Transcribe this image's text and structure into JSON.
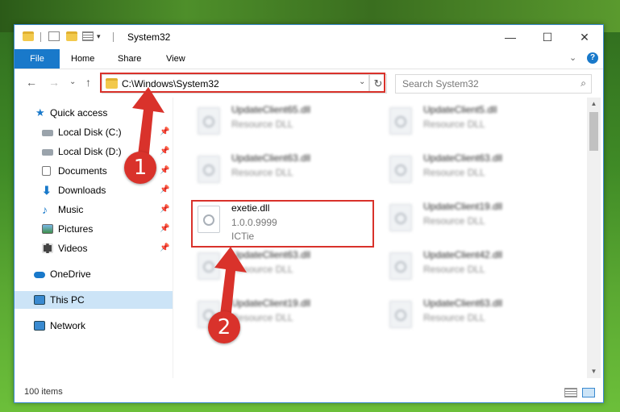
{
  "window": {
    "title": "System32",
    "controls": {
      "minimize": "—",
      "maximize": "☐",
      "close": "✕"
    }
  },
  "ribbon": {
    "file": "File",
    "home": "Home",
    "share": "Share",
    "view": "View",
    "collapse": "⌄",
    "help": "?"
  },
  "address": {
    "path": "C:\\Windows\\System32",
    "dropdown": "⌄",
    "refresh": "↻"
  },
  "search": {
    "placeholder": "Search System32",
    "icon": "⌕"
  },
  "nav": {
    "back": "←",
    "forward": "→",
    "recent": "⌄",
    "up": "↑"
  },
  "sidebar": {
    "items": [
      {
        "label": "Quick access",
        "icon": "star-icon"
      },
      {
        "label": "Local Disk (C:)",
        "icon": "drive-icon",
        "pinned": true
      },
      {
        "label": "Local Disk (D:)",
        "icon": "drive-icon",
        "pinned": true
      },
      {
        "label": "Documents",
        "icon": "documents-icon",
        "pinned": true
      },
      {
        "label": "Downloads",
        "icon": "downloads-icon",
        "pinned": true
      },
      {
        "label": "Music",
        "icon": "music-icon",
        "pinned": true
      },
      {
        "label": "Pictures",
        "icon": "pictures-icon",
        "pinned": true
      },
      {
        "label": "Videos",
        "icon": "videos-icon",
        "pinned": true
      },
      {
        "label": "OneDrive",
        "icon": "onedrive-icon"
      },
      {
        "label": "This PC",
        "icon": "pc-icon",
        "selected": true
      },
      {
        "label": "Network",
        "icon": "network-icon"
      }
    ],
    "pin_glyph": "📌"
  },
  "files": [
    {
      "name": "UpdateClient65.dll",
      "type": "Resource DLL"
    },
    {
      "name": "UpdateClient5.dll",
      "type": "Resource DLL"
    },
    {
      "name": "UpdateClient63.dll",
      "type": "Resource DLL"
    },
    {
      "name": "UpdateClient63.dll",
      "type": "Resource DLL"
    },
    {
      "name": "exetie.dll",
      "version": "1.0.0.9999",
      "company": "ICTie",
      "highlighted": true
    },
    {
      "name": "UpdateClient19.dll",
      "type": "Resource DLL"
    },
    {
      "name": "UpdateClient63.dll",
      "type": "Resource DLL"
    },
    {
      "name": "UpdateClient42.dll",
      "type": "Resource DLL"
    },
    {
      "name": "UpdateClient19.dll",
      "type": "Resource DLL"
    },
    {
      "name": "UpdateClient63.dll",
      "type": "Resource DLL"
    }
  ],
  "status": {
    "count": "100 items"
  },
  "callouts": {
    "one": "1",
    "two": "2"
  },
  "colors": {
    "accent": "#1979ca",
    "highlight": "#d9322b",
    "selected": "#cce4f7"
  }
}
